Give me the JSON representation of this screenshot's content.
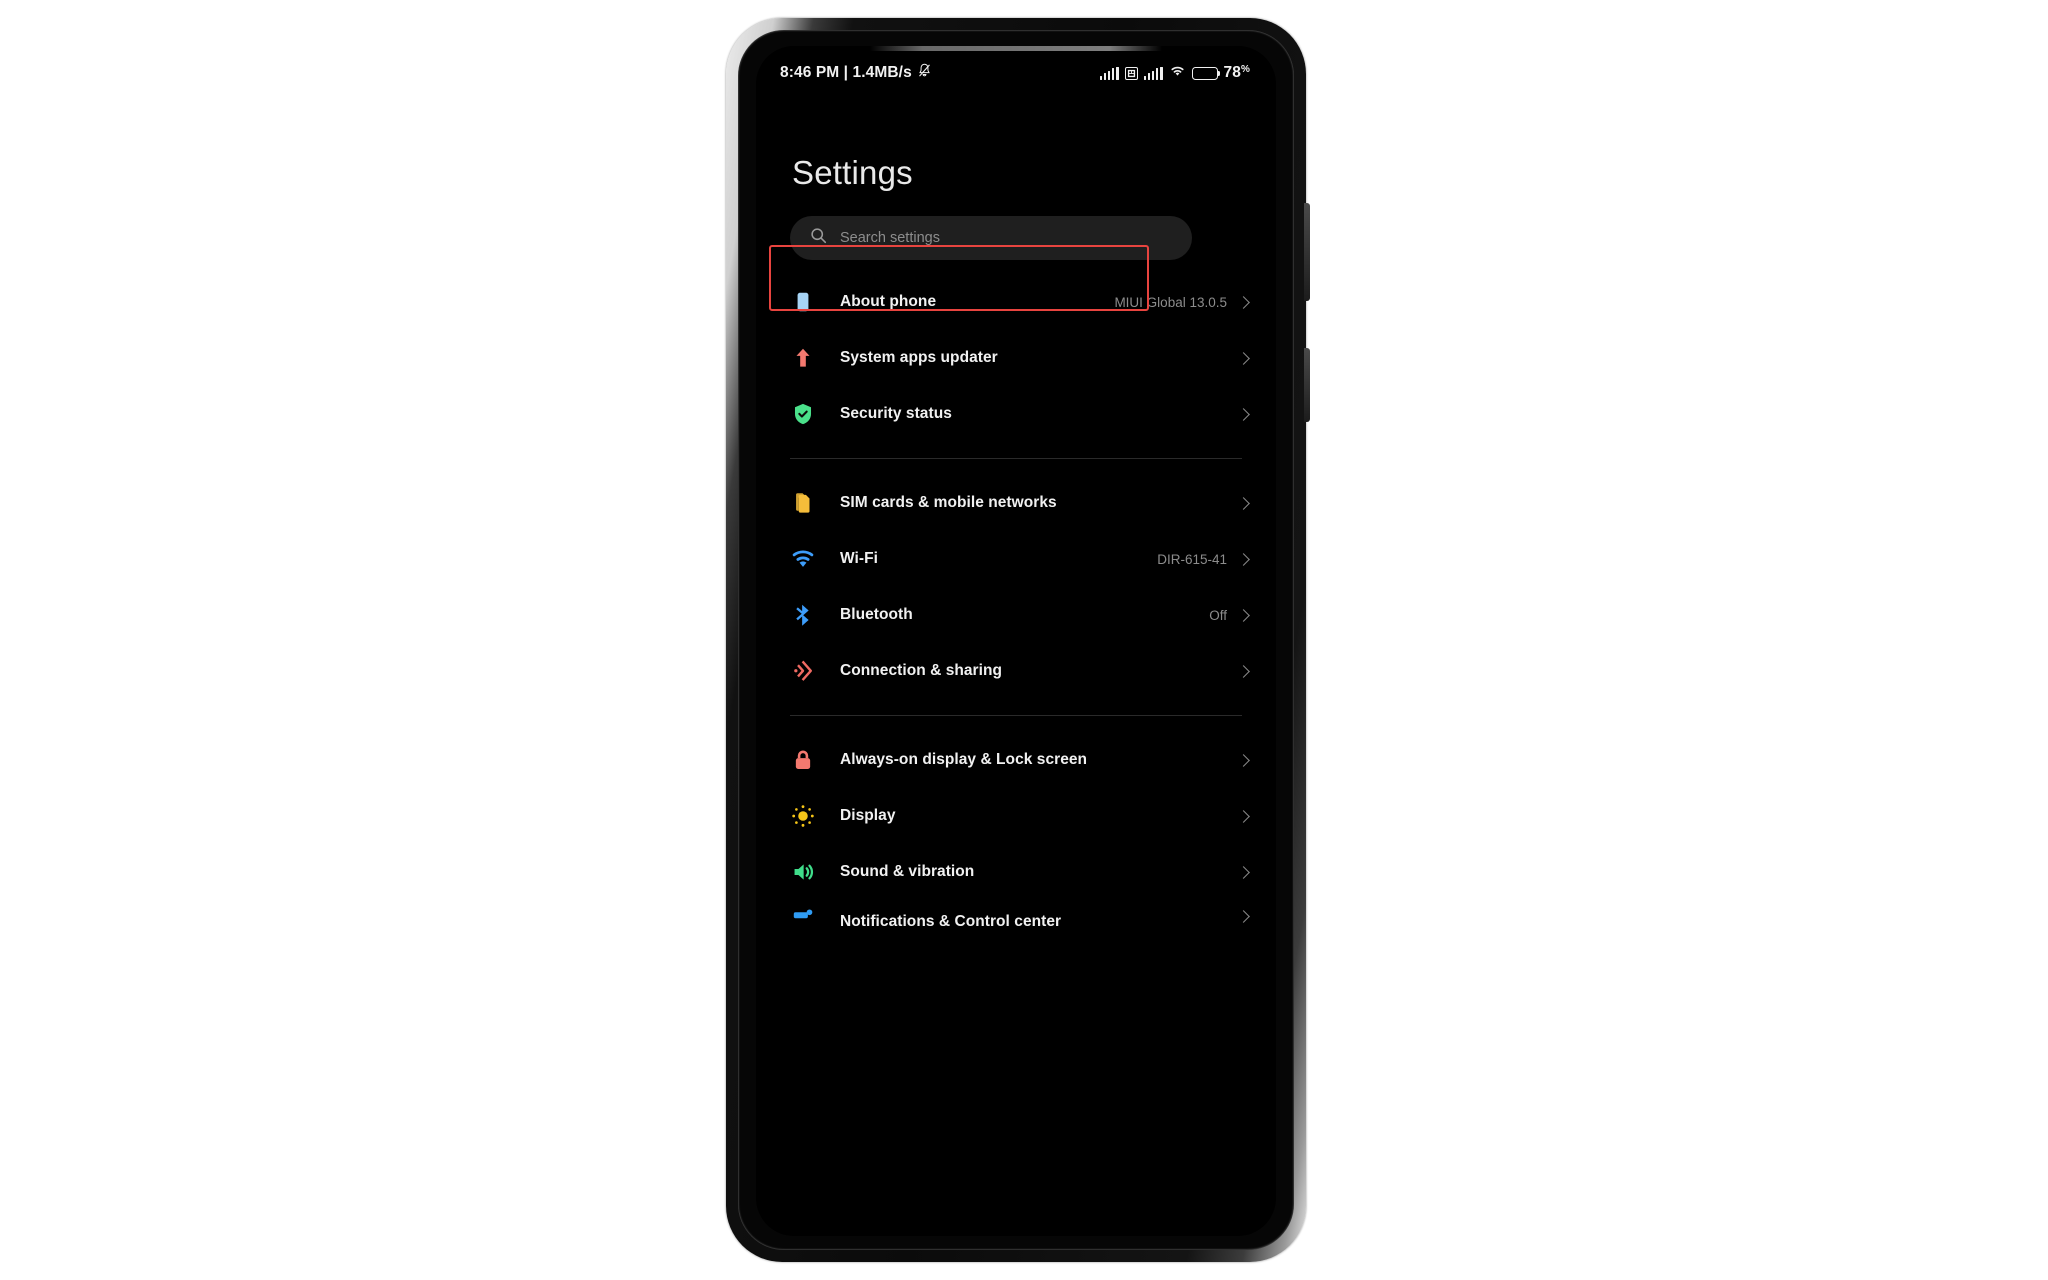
{
  "status_bar": {
    "time_and_data": "8:46 PM | 1.4MB/s",
    "mute_icon": "bell-mute-icon",
    "signal_1_icon": "signal-bars-icon",
    "sim_badge_icon": "sim-indicator-icon",
    "signal_2_icon": "signal-bars-icon",
    "wifi_icon": "wifi-icon",
    "battery_icon": "battery-icon",
    "battery_percent": "78",
    "battery_percent_symbol": "%",
    "battery_level_value": 78
  },
  "header": {
    "title": "Settings"
  },
  "search": {
    "icon": "search-icon",
    "placeholder": "Search settings",
    "value": ""
  },
  "highlight": {
    "target": "About phone",
    "color": "#e8443f"
  },
  "groups": [
    {
      "name": "device-status-group",
      "rows": [
        {
          "name": "about-phone",
          "label": "About phone",
          "value": "MIUI Global 13.0.5",
          "icon": "phone-icon",
          "icon_color": "#a7d4f5",
          "highlighted": true
        },
        {
          "name": "system-apps-updater",
          "label": "System apps updater",
          "value": "",
          "icon": "up-arrow-icon",
          "icon_color": "#f4796f"
        },
        {
          "name": "security-status",
          "label": "Security status",
          "value": "",
          "icon": "shield-check-icon",
          "icon_color": "#4ae08a"
        }
      ]
    },
    {
      "name": "connectivity-group",
      "rows": [
        {
          "name": "sim-cards-mobile-networks",
          "label": "SIM cards & mobile networks",
          "value": "",
          "icon": "sim-card-icon",
          "icon_color": "#f5bd3a"
        },
        {
          "name": "wifi",
          "label": "Wi-Fi",
          "value": "DIR-615-41",
          "icon": "wifi-icon",
          "icon_color": "#3d9dfa"
        },
        {
          "name": "bluetooth",
          "label": "Bluetooth",
          "value": "Off",
          "icon": "bluetooth-icon",
          "icon_color": "#3d9dfa"
        },
        {
          "name": "connection-sharing",
          "label": "Connection & sharing",
          "value": "",
          "icon": "connection-sharing-icon",
          "icon_color": "#ef6a62"
        }
      ]
    },
    {
      "name": "personalization-group",
      "rows": [
        {
          "name": "always-on-display-lock-screen",
          "label": "Always-on display & Lock screen",
          "value": "",
          "icon": "lock-icon",
          "icon_color": "#f4796f"
        },
        {
          "name": "display",
          "label": "Display",
          "value": "",
          "icon": "sun-icon",
          "icon_color": "#f5c518"
        },
        {
          "name": "sound-vibration",
          "label": "Sound & vibration",
          "value": "",
          "icon": "speaker-icon",
          "icon_color": "#3fdd8a"
        },
        {
          "name": "notifications-control-center",
          "label": "Notifications & Control center",
          "value": "",
          "icon": "notification-icon",
          "icon_color": "#2f9cf4",
          "cut_off": true
        }
      ]
    }
  ]
}
